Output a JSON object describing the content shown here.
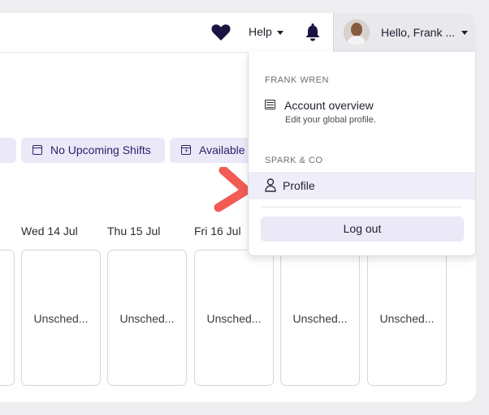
{
  "header": {
    "help_label": "Help",
    "user_greeting": "Hello, Frank ..."
  },
  "filters": {
    "chips": [
      {
        "label": "No Upcoming Shifts"
      },
      {
        "label": "Available"
      }
    ]
  },
  "schedule": {
    "days": [
      {
        "label": "Wed 14 Jul",
        "status": "Unsched..."
      },
      {
        "label": "Thu 15 Jul",
        "status": "Unsched..."
      },
      {
        "label": "Fri 16 Jul",
        "status": "Unsched..."
      },
      {
        "label": "",
        "status": "Unsched..."
      },
      {
        "label": "",
        "status": "Unsched..."
      }
    ]
  },
  "dropdown": {
    "user_section": "FRANK WREN",
    "account_overview": {
      "title": "Account overview",
      "subtitle": "Edit your global profile."
    },
    "org_section": "SPARK & CO",
    "profile_label": "Profile",
    "logout_label": "Log out"
  },
  "colors": {
    "accent": "#2d1f6b",
    "chip_bg": "#ebe8f7",
    "pointer_arrow": "#f25c54"
  },
  "icons": {
    "favorites": "heart-icon",
    "notifications": "bell-icon",
    "account": "list-icon",
    "profile": "person-icon"
  }
}
